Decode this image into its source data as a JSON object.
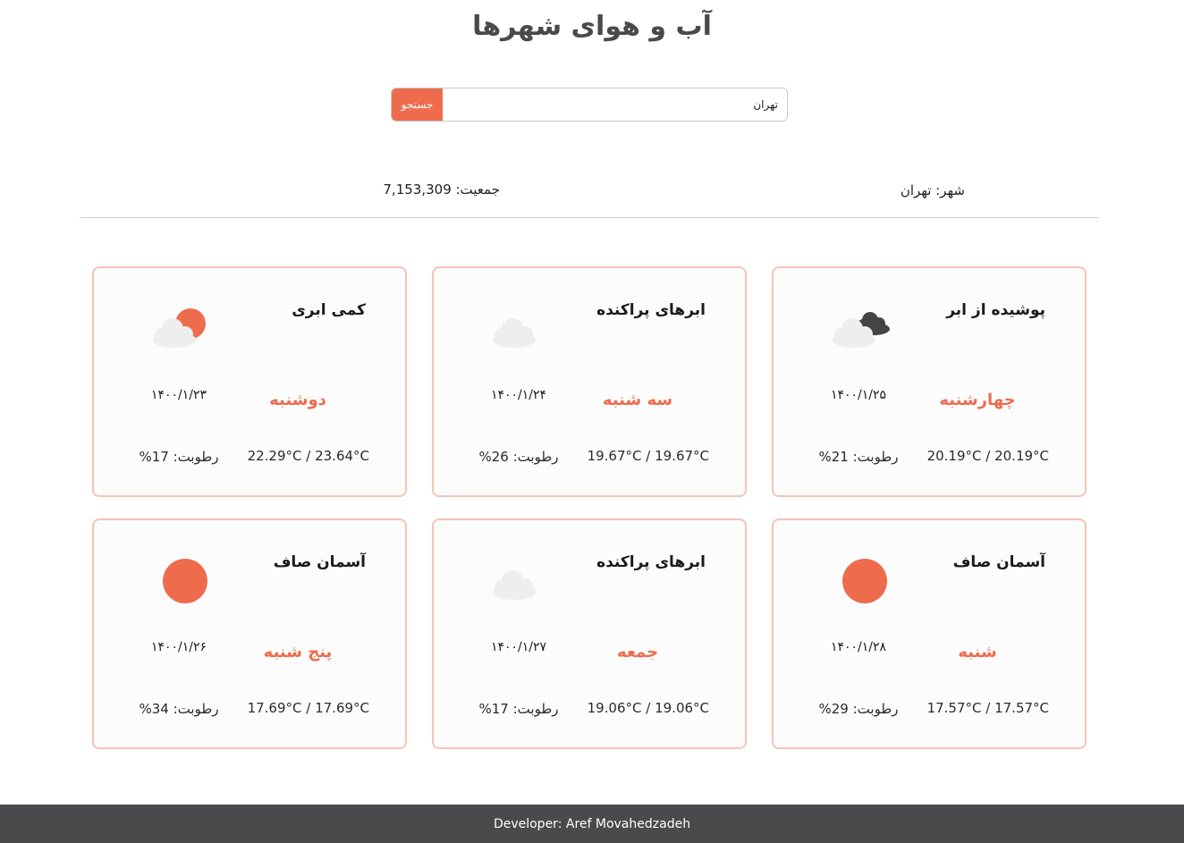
{
  "page": {
    "title": "آب و هوای شهرها"
  },
  "search": {
    "value": "تهران",
    "button_label": "جستجو"
  },
  "city": {
    "name_label": "شهر: تهران",
    "population_label": "جمعیت: 7,153,309"
  },
  "colors": {
    "accent": "#ee6c4d",
    "cloud_light": "#eeeeee",
    "cloud_dark": "#444444",
    "footer_bg": "#4a4a4c",
    "card_border": "#f8c2b5"
  },
  "forecast": [
    {
      "description": "کمی ابری",
      "icon": "sun-behind-cloud-icon",
      "weekday": "دوشنبه",
      "date": "۱۴۰۰/۱/۲۳",
      "temps": "22.29°C / 23.64°C",
      "humidity": "رطوبت: 17%"
    },
    {
      "description": "ابرهای پراکنده",
      "icon": "cloud-icon",
      "weekday": "سه شنبه",
      "date": "۱۴۰۰/۱/۲۴",
      "temps": "19.67°C / 19.67°C",
      "humidity": "رطوبت: 26%"
    },
    {
      "description": "پوشیده از ابر",
      "icon": "overcast-clouds-icon",
      "weekday": "چهارشنبه",
      "date": "۱۴۰۰/۱/۲۵",
      "temps": "20.19°C / 20.19°C",
      "humidity": "رطوبت: 21%"
    },
    {
      "description": "آسمان صاف",
      "icon": "sun-icon",
      "weekday": "پنج شنبه",
      "date": "۱۴۰۰/۱/۲۶",
      "temps": "17.69°C / 17.69°C",
      "humidity": "رطوبت: 34%"
    },
    {
      "description": "ابرهای پراکنده",
      "icon": "cloud-icon",
      "weekday": "جمعه",
      "date": "۱۴۰۰/۱/۲۷",
      "temps": "19.06°C / 19.06°C",
      "humidity": "رطوبت: 17%"
    },
    {
      "description": "آسمان صاف",
      "icon": "sun-icon",
      "weekday": "شنبه",
      "date": "۱۴۰۰/۱/۲۸",
      "temps": "17.57°C / 17.57°C",
      "humidity": "رطوبت: 29%"
    }
  ],
  "footer": {
    "text": "Developer: Aref Movahedzadeh"
  }
}
